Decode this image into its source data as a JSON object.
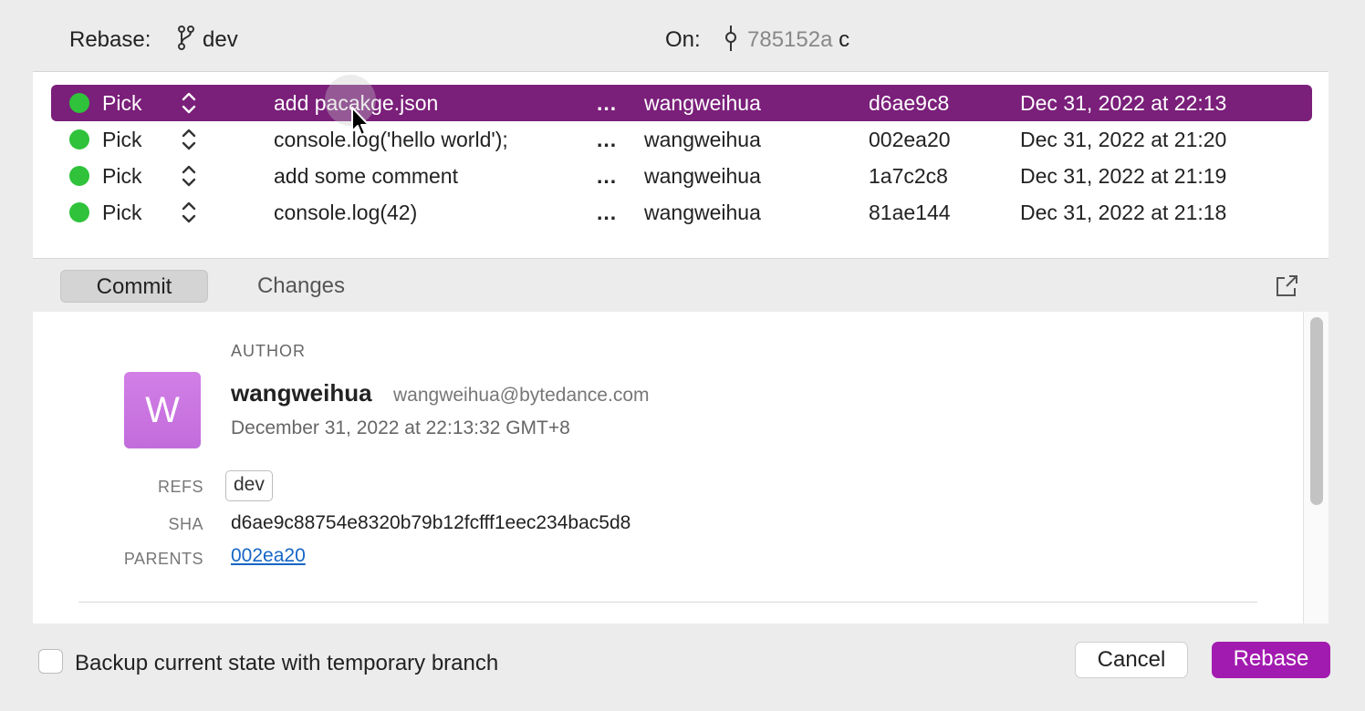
{
  "header": {
    "rebase_label": "Rebase:",
    "branch_icon": "branch-icon",
    "branch": "dev",
    "on_label": "On:",
    "commit_icon": "commit-icon",
    "on_sha": "785152a",
    "on_message": "c"
  },
  "commits": [
    {
      "action": "Pick",
      "message": "add pacakge.json",
      "more": "...",
      "author": "wangweihua",
      "sha": "d6ae9c8",
      "date": "Dec 31, 2022 at 22:13",
      "selected": true
    },
    {
      "action": "Pick",
      "message": "console.log('hello world');",
      "more": "...",
      "author": "wangweihua",
      "sha": "002ea20",
      "date": "Dec 31, 2022 at 21:20",
      "selected": false
    },
    {
      "action": "Pick",
      "message": "add some comment",
      "more": "...",
      "author": "wangweihua",
      "sha": "1a7c2c8",
      "date": "Dec 31, 2022 at 21:19",
      "selected": false
    },
    {
      "action": "Pick",
      "message": "console.log(42)",
      "more": "...",
      "author": "wangweihua",
      "sha": "81ae144",
      "date": "Dec 31, 2022 at 21:18",
      "selected": false
    }
  ],
  "tabs": {
    "commit": "Commit",
    "changes": "Changes",
    "open_icon": "open-external-icon"
  },
  "detail": {
    "author_heading": "AUTHOR",
    "avatar_letter": "W",
    "author_name": "wangweihua",
    "author_email": "wangweihua@bytedance.com",
    "author_date": "December 31, 2022 at 22:13:32 GMT+8",
    "refs_label": "REFS",
    "ref": "dev",
    "sha_label": "SHA",
    "sha": "d6ae9c88754e8320b79b12fcfff1eec234bac5d8",
    "parents_label": "PARENTS",
    "parent": "002ea20"
  },
  "footer": {
    "backup_label": "Backup current state with temporary branch",
    "cancel": "Cancel",
    "rebase": "Rebase"
  },
  "colors": {
    "selected_row": "#7a1f7a",
    "status_green": "#2fc23a",
    "rebase_button": "#a21bb0",
    "link": "#1566c6",
    "avatar": "#c26cdc"
  }
}
